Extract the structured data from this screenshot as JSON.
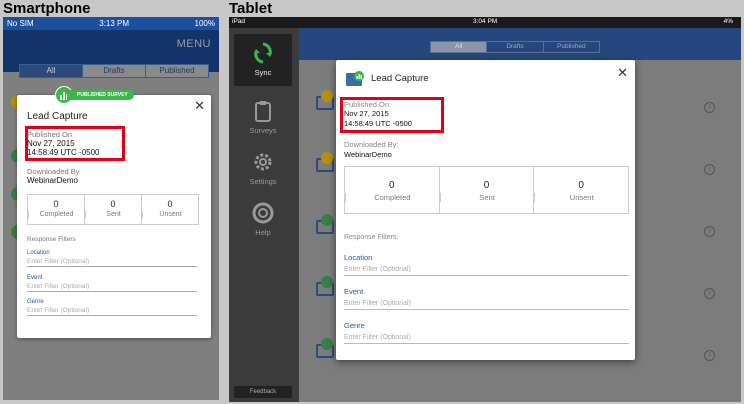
{
  "labels": {
    "smartphone": "Smartphone",
    "tablet": "Tablet"
  },
  "phone": {
    "status": {
      "carrier": "No SIM",
      "time": "3:13 PM",
      "battery": "100%"
    },
    "menu": "MENU",
    "segments": [
      "All",
      "Drafts",
      "Published"
    ],
    "badge": "PUBLISHED SURVEY",
    "card": {
      "title": "Lead Capture",
      "published_on_label": "Published On",
      "published_date": "Nov 27, 2015",
      "published_time": "14:58:49 UTC -0500",
      "downloaded_by_label": "Downloaded By",
      "downloaded_by": "WebinarDemo",
      "stats": [
        {
          "value": "0",
          "label": "Completed"
        },
        {
          "value": "0",
          "label": "Sent"
        },
        {
          "value": "0",
          "label": "Unsent"
        }
      ],
      "response_filters_label": "Response Filters",
      "filters": [
        {
          "label": "Location",
          "placeholder": "Enter Filter (Optional)"
        },
        {
          "label": "Event",
          "placeholder": "Enter Filter (Optional)"
        },
        {
          "label": "Genre",
          "placeholder": "Enter Filter (Optional)"
        }
      ]
    }
  },
  "tablet": {
    "status": {
      "device": "iPad",
      "time": "3:04 PM",
      "battery": "4%"
    },
    "sidebar": [
      {
        "label": "Sync",
        "icon": "sync-icon"
      },
      {
        "label": "Surveys",
        "icon": "clipboard-icon"
      },
      {
        "label": "Settings",
        "icon": "gear-icon"
      },
      {
        "label": "Help",
        "icon": "lifebuoy-icon"
      }
    ],
    "feedback": "Feedback",
    "segments": [
      "All",
      "Drafts",
      "Published"
    ],
    "card": {
      "title": "Lead Capture",
      "published_on_label": "Published On:",
      "published_date": "Nov 27, 2015",
      "published_time": "14:58:49 UTC -0500",
      "downloaded_by_label": "Downloaded By:",
      "downloaded_by": "WebinarDemo",
      "stats": [
        {
          "value": "0",
          "label": "Completed"
        },
        {
          "value": "0",
          "label": "Sent"
        },
        {
          "value": "0",
          "label": "Unsent"
        }
      ],
      "response_filters_label": "Response Filters:",
      "filters": [
        {
          "label": "Location",
          "placeholder": "Enter Filter (Optional)"
        },
        {
          "label": "Event",
          "placeholder": "Enter Filter (Optional)"
        },
        {
          "label": "Genre",
          "placeholder": "Enter Filter (Optional)"
        }
      ]
    }
  },
  "colors": {
    "highlight": "#e0001a",
    "accent": "#1e56b0",
    "success": "#3cb54a"
  }
}
